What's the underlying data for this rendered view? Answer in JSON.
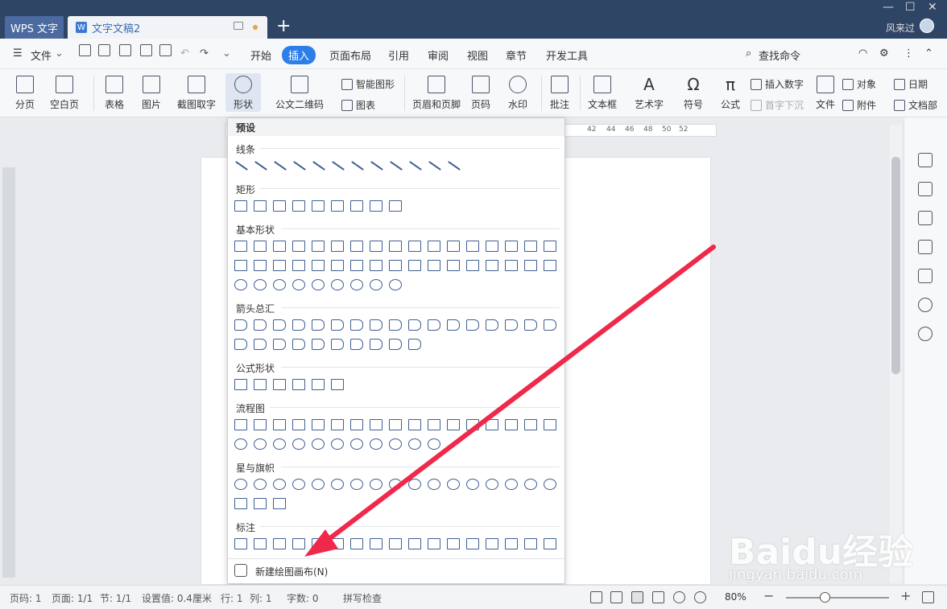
{
  "titlebar": {
    "app_tab": "WPS 文字",
    "doc_tab": "文字文稿2",
    "new_tab": "+",
    "user": "风来过"
  },
  "menubar": {
    "file": "文件",
    "items": [
      "开始",
      "插入",
      "页面布局",
      "引用",
      "审阅",
      "视图",
      "章节",
      "开发工具"
    ],
    "search": "查找命令"
  },
  "ribbon": {
    "items": [
      "分页",
      "空白页",
      "表格",
      "图片",
      "截图取字",
      "形状",
      "公文二维码",
      "页眉和页脚",
      "页码",
      "水印",
      "批注",
      "文本框",
      "艺术字",
      "符号",
      "公式",
      "文件"
    ],
    "small": {
      "smart_shape": "智能图形",
      "chart": "图表",
      "insert_number": "插入数字",
      "first_sink": "首字下沉",
      "object": "对象",
      "date": "日期",
      "attachment": "附件",
      "doc_part": "文档部"
    }
  },
  "ruler": {
    "ticks": [
      "42",
      "44",
      "46",
      "48",
      "50",
      "52"
    ]
  },
  "dropdown": {
    "header": "预设",
    "sections": [
      "线条",
      "矩形",
      "基本形状",
      "箭头总汇",
      "公式形状",
      "流程图",
      "星与旗帜",
      "标注"
    ],
    "new_canvas": "新建绘图画布(N)"
  },
  "statusbar": {
    "page_num": "页码: 1",
    "pages": "页面: 1/1",
    "section": "节: 1/1",
    "setting": "设置值: 0.4厘米",
    "row": "行: 1",
    "col": "列: 1",
    "words": "字数: 0",
    "spell": "拼写检查",
    "zoom": "80%"
  },
  "watermark": {
    "brand": "Baidu经验",
    "url": "jingyan.baidu.com"
  }
}
